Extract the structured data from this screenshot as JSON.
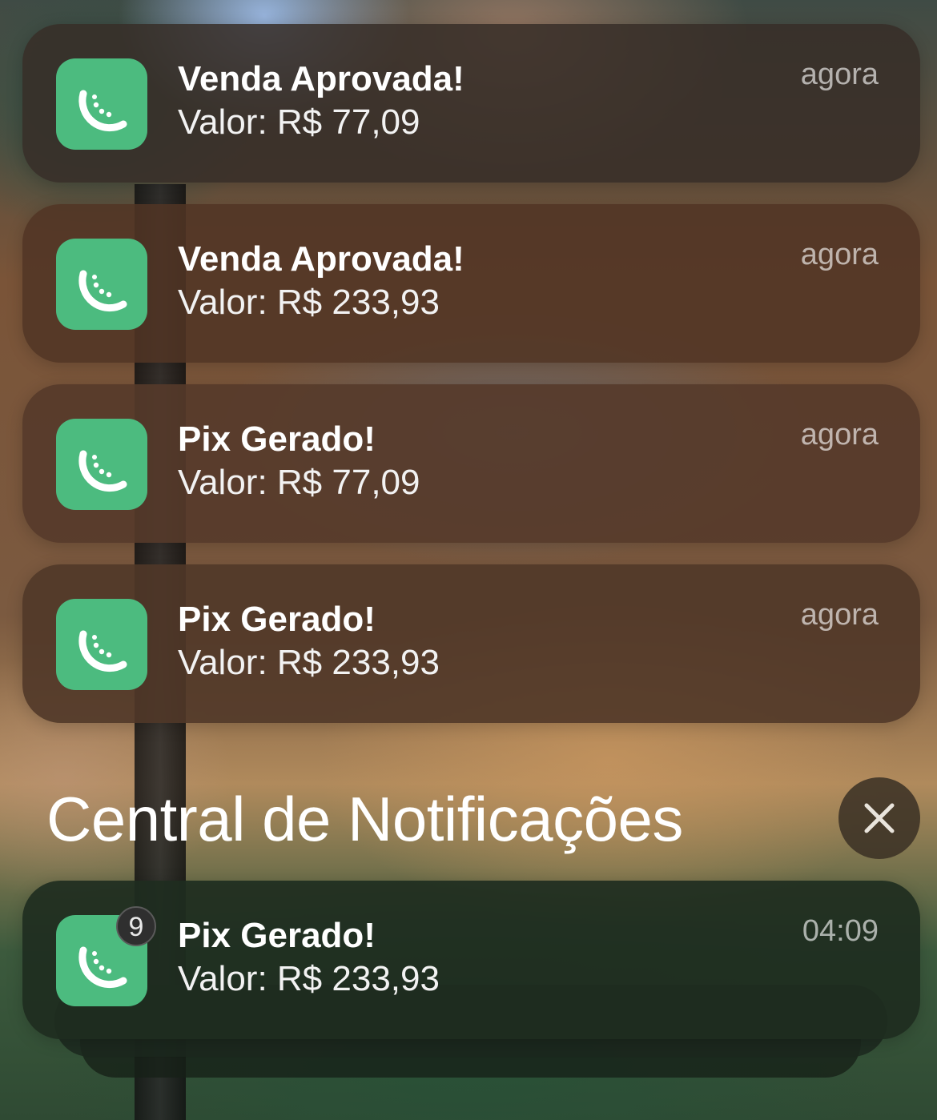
{
  "notifications": [
    {
      "title": "Venda Aprovada!",
      "body": "Valor: R$ 77,09",
      "time": "agora",
      "icon": "lime-slice-icon"
    },
    {
      "title": "Venda Aprovada!",
      "body": "Valor: R$ 233,93",
      "time": "agora",
      "icon": "lime-slice-icon"
    },
    {
      "title": "Pix Gerado!",
      "body": "Valor: R$ 77,09",
      "time": "agora",
      "icon": "lime-slice-icon"
    },
    {
      "title": "Pix Gerado!",
      "body": "Valor: R$ 233,93",
      "time": "agora",
      "icon": "lime-slice-icon"
    }
  ],
  "notification_center": {
    "title": "Central de Notificações",
    "close_icon": "close-icon"
  },
  "grouped_notification": {
    "badge_count": "9",
    "title": "Pix Gerado!",
    "body": "Valor: R$ 233,93",
    "time": "04:09",
    "icon": "lime-slice-icon"
  },
  "colors": {
    "app_icon": "#4cbb7f",
    "text_primary": "#ffffff",
    "text_secondary": "rgba(255,255,255,0.62)"
  }
}
